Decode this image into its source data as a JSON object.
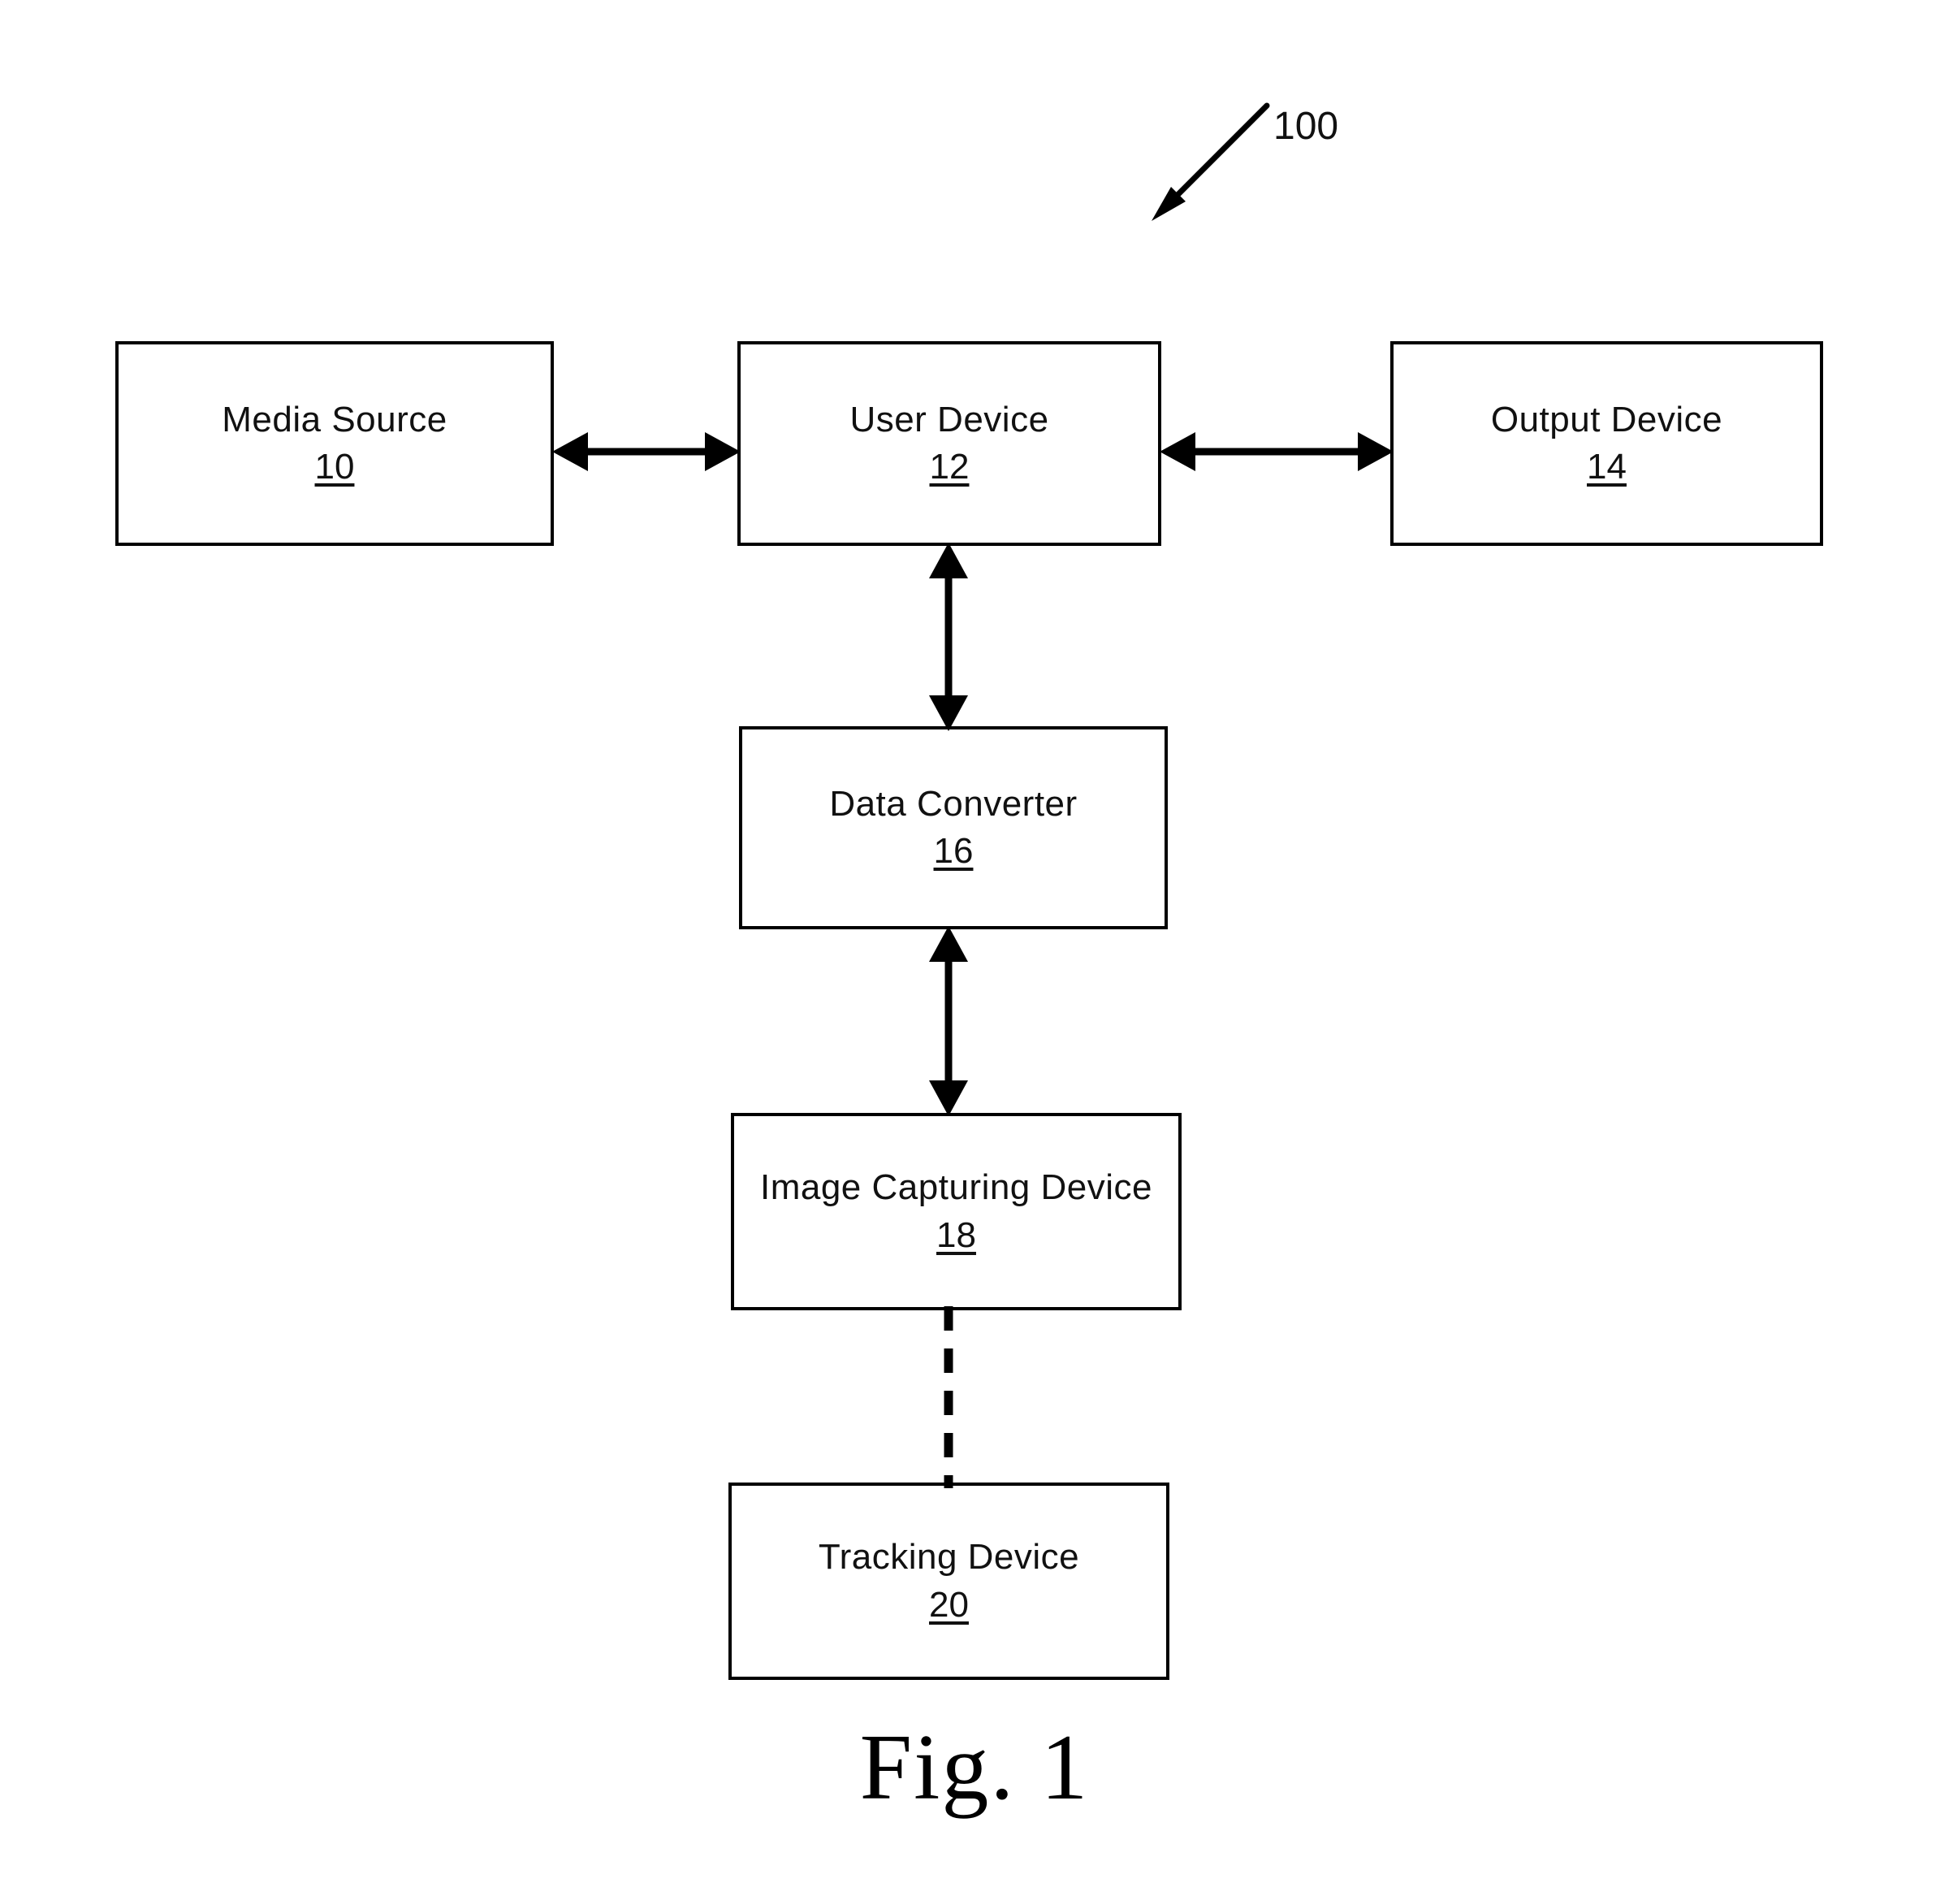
{
  "figure": {
    "caption": "Fig. 1",
    "system_reference": "100"
  },
  "nodes": [
    {
      "id": "media-source",
      "label": "Media Source",
      "ref": "10"
    },
    {
      "id": "user-device",
      "label": "User Device",
      "ref": "12"
    },
    {
      "id": "output-device",
      "label": "Output Device",
      "ref": "14"
    },
    {
      "id": "data-converter",
      "label": "Data Converter",
      "ref": "16"
    },
    {
      "id": "image-capturing",
      "label": "Image Capturing Device",
      "ref": "18"
    },
    {
      "id": "tracking-device",
      "label": "Tracking Device",
      "ref": "20"
    }
  ],
  "connections": [
    {
      "id": "media-source-to-user-device",
      "from": "media-source",
      "to": "user-device",
      "style": "solid",
      "arrows": "both"
    },
    {
      "id": "user-device-to-output-device",
      "from": "user-device",
      "to": "output-device",
      "style": "solid",
      "arrows": "both"
    },
    {
      "id": "user-device-to-data-converter",
      "from": "user-device",
      "to": "data-converter",
      "style": "solid",
      "arrows": "both"
    },
    {
      "id": "data-converter-to-image-capturing",
      "from": "data-converter",
      "to": "image-capturing",
      "style": "solid",
      "arrows": "both"
    },
    {
      "id": "image-capturing-to-tracking-device",
      "from": "image-capturing",
      "to": "tracking-device",
      "style": "dashed",
      "arrows": "none"
    }
  ],
  "colors": {
    "line": "#000000",
    "text": "#111111",
    "background": "#ffffff"
  }
}
